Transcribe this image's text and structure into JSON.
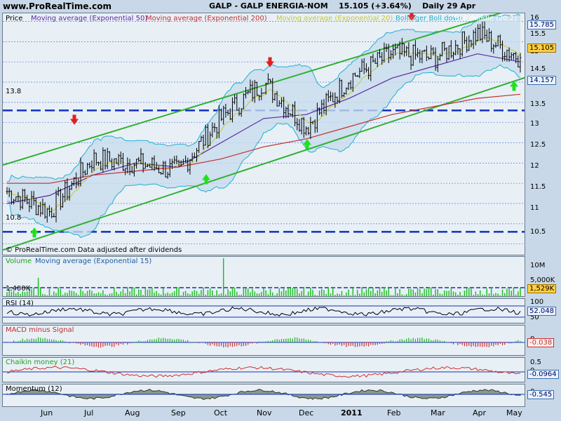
{
  "header": {
    "brand": "www.ProRealTime.com",
    "title": "GALP - GALP ENERGIA-NOM",
    "last": "15.105 (+3.64%)",
    "period": "Daily  29 Apr"
  },
  "price_panel": {
    "label": "Price",
    "legend": [
      {
        "text": "Moving average (Exponential 50)",
        "color": "#5a2aa0"
      },
      {
        "text": "Moving average (Exponential 200)",
        "color": "#c03030"
      },
      {
        "text": "Moving average (Exponential 20)",
        "color": "#c8c830"
      },
      {
        "text": "Bollinger Boll down",
        "color": "#20b0d0"
      },
      {
        "text": "Boll middle (20,2)",
        "color": "#ffffff"
      }
    ],
    "copyright": "© ProRealTime.com  Data adjusted after dividends",
    "level_labels": [
      "13.8",
      "10.8"
    ],
    "ticks": [
      "16",
      "15.5",
      "15",
      "14.5",
      "14",
      "13.5",
      "13",
      "12.5",
      "12",
      "11.5",
      "11",
      "10.5"
    ],
    "flags": {
      "boll_up": "15.785",
      "price": "15.105",
      "boll_down": "14.157"
    }
  },
  "volume_panel": {
    "label": "Volume",
    "ma_label": "Moving average (Exponential 15)",
    "level_label": "1,400K",
    "ticks": [
      "10M",
      "5,000K"
    ],
    "flag": "1,529K"
  },
  "rsi_panel": {
    "label": "RSI (14)",
    "ticks": [
      "100",
      "50"
    ],
    "flag": "52.048"
  },
  "macd_panel": {
    "label": "MACD minus Signal",
    "ticks": [
      "0"
    ],
    "flag": "-0.038"
  },
  "chaikin_panel": {
    "label": "Chaikin money (21)",
    "ticks": [
      "0.5",
      "0"
    ],
    "flag": "-0.0964"
  },
  "momentum_panel": {
    "label": "Momentum (12)",
    "ticks": [
      "0"
    ],
    "flag": "-0.545"
  },
  "x_axis": {
    "months": [
      "Jun",
      "Jul",
      "Aug",
      "Sep",
      "Oct",
      "Nov",
      "Dec",
      "2011",
      "Feb",
      "Mar",
      "Apr",
      "May"
    ]
  },
  "chart_data": {
    "type": "line",
    "title": "GALP - GALP ENERGIA-NOM",
    "x": [
      "May",
      "Jun",
      "Jul",
      "Aug",
      "Sep",
      "Oct",
      "Nov",
      "Dec",
      "Jan",
      "Feb",
      "Mar",
      "Apr",
      "May"
    ],
    "series": [
      {
        "name": "Price",
        "values": [
          11.8,
          11.3,
          12.6,
          12.5,
          12.3,
          13.6,
          14.5,
          13.4,
          14.6,
          15.2,
          15.1,
          15.7,
          15.105
        ]
      },
      {
        "name": "Moving average (Exponential 50)",
        "values": [
          11.5,
          11.7,
          12.2,
          12.5,
          12.4,
          13.0,
          13.6,
          13.7,
          14.1,
          14.6,
          14.9,
          15.2,
          15.0
        ]
      },
      {
        "name": "Moving average (Exponential 200)",
        "values": [
          12.0,
          12.0,
          12.2,
          12.3,
          12.4,
          12.6,
          12.9,
          13.1,
          13.4,
          13.7,
          13.9,
          14.1,
          14.2
        ]
      }
    ],
    "horizontal_levels": [
      13.8,
      10.8
    ],
    "ylim": [
      10.2,
      16.2
    ],
    "last_value": 15.105,
    "change_pct": 3.64
  }
}
